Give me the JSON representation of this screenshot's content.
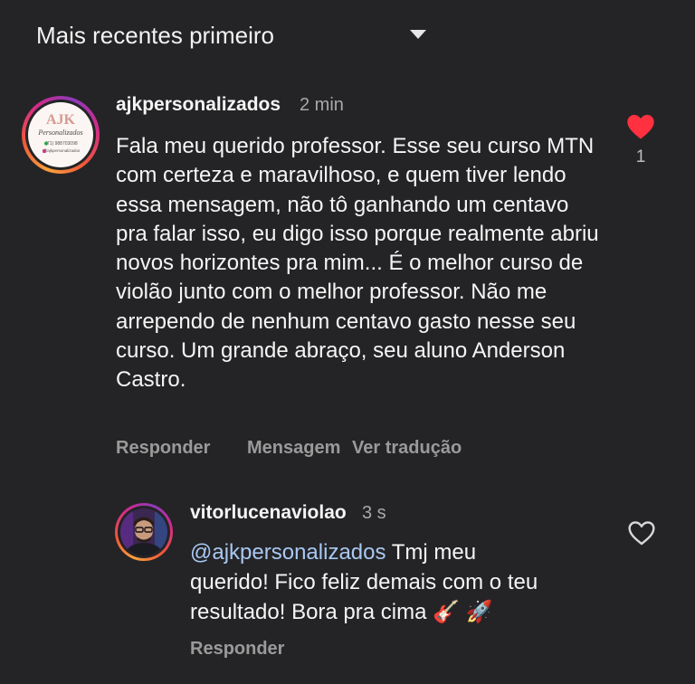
{
  "sort": {
    "label": "Mais recentes primeiro"
  },
  "comments": [
    {
      "username": "ajkpersonalizados",
      "time": "2 min",
      "text": "Fala meu querido professor. Esse seu curso MTN com certeza e maravilhoso, e quem tiver lendo essa mensagem, não tô ganhando um centavo pra falar isso, eu digo isso porque realmente abriu novos horizontes pra mim... É o melhor curso de violão junto com o melhor professor. Não me arrependo de nenhum centavo gasto nesse seu curso. Um grande abraço, seu aluno Anderson Castro.",
      "actions": {
        "reply": "Responder",
        "message": "Mensagem",
        "translate": "Ver tradução"
      },
      "likes": "1",
      "liked": true,
      "avatar": {
        "logo_text": "AJK",
        "script_text": "Personalizados",
        "phone": "(71) 988703098",
        "handle": "@ajkpersonalizados"
      }
    },
    {
      "username": "vitorlucenaviolao",
      "time": "3 s",
      "mention": "@ajkpersonalizados",
      "text": " Tmj meu querido! Fico feliz demais com o teu resultado! Bora pra cima 🎸 🚀",
      "actions": {
        "reply": "Responder"
      },
      "liked": false
    }
  ],
  "colors": {
    "background": "#242426",
    "heart_liked": "#ff3040",
    "mention": "#a9c8f2",
    "secondary_text": "#9a9a9a"
  }
}
